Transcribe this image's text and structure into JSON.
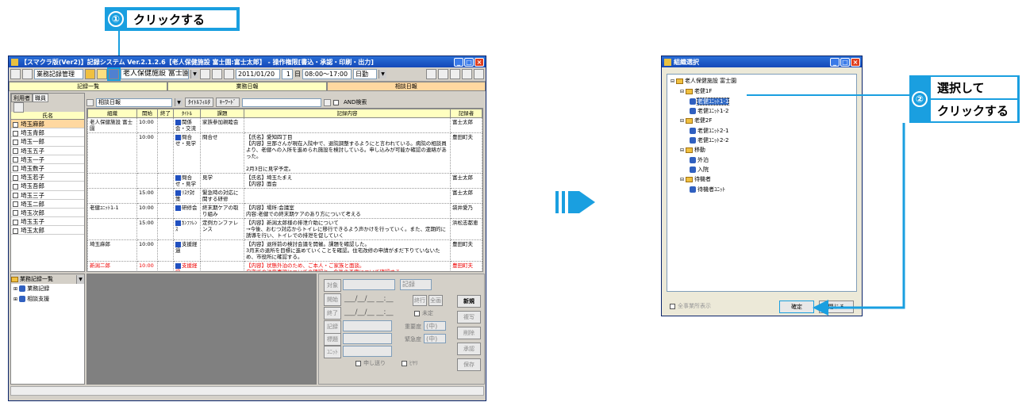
{
  "callout1": {
    "num": "①",
    "text": "クリックする"
  },
  "callout2": {
    "num": "②",
    "line1": "選択して",
    "line2": "クリックする"
  },
  "main_window": {
    "title": "【スマクラ版(Ver2)】記録システム Ver.2.1.2.6【老人保健施設 富士園:富士太郎】 - 操作権限[書込・承認・印刷・出力]",
    "toolbar": {
      "mode": "業務記録管理",
      "facility": "老人保健施設 富士園",
      "date": "2011/01/20",
      "day_value": "1",
      "day_unit": "日",
      "time": "08:00～17:00",
      "time_mode": "日勤"
    },
    "tabs": [
      "記録一覧",
      "業務日報",
      "相談日報"
    ],
    "left_tabs": [
      "利用者",
      "職員"
    ],
    "filter": {
      "select": "相談日報",
      "btn1": "ﾀｲﾄﾙﾌｨﾙﾀ",
      "btn2": "ｷｰﾜｰﾄﾞ",
      "and_label": "AND検索"
    },
    "name_header": "氏名",
    "names": [
      "埼玉麻郎",
      "埼玉青郎",
      "埼玉一郎",
      "埼玉五子",
      "埼玉一子",
      "埼玉数子",
      "埼玉若子",
      "埼玉吾郎",
      "埼玉三子",
      "埼玉二郎",
      "埼玉次郎",
      "埼玉玉子",
      "埼玉太郎"
    ],
    "columns": [
      "組織",
      "開始",
      "終了",
      "ﾀｲﾄﾙ",
      "課題",
      "記録内容",
      "記録者"
    ],
    "rows": [
      {
        "org": "老人保健施設 富士園",
        "start": "10:00",
        "end": "",
        "title": "関係会・交流",
        "issue": "家族参加親睦会",
        "content": "",
        "recorder": "富士太郎",
        "red": false
      },
      {
        "org": "",
        "start": "10:00",
        "end": "",
        "title": "問合せ・見学",
        "issue": "問合せ",
        "content": "【氏名】愛知四丁目\n【内容】旦那さんが現在入院中で、退院調整するようにと言われている。病院の相談員より、老健への入所を進められ施設を検討している。申し込みが可能か確認の連絡があった。\n\n2月3日に見学予定。",
        "recorder": "豊田町夫",
        "red": false
      },
      {
        "org": "",
        "start": "",
        "end": "",
        "title": "問合せ・見学",
        "issue": "見学",
        "content": "【氏名】埼玉たまえ\n【内容】面会",
        "recorder": "富士太郎",
        "red": false
      },
      {
        "org": "",
        "start": "15:00",
        "end": "",
        "title": "ﾘｽｸ対策",
        "issue": "緊急時の対応に関する研修",
        "content": "",
        "recorder": "富士太郎",
        "red": false
      },
      {
        "org": "老健ﾕﾆｯﾄ1-1",
        "start": "10:00",
        "end": "",
        "title": "研修会",
        "issue": "終末期ケアの取り組み",
        "content": "【内容】場所:会議室\n内容:老健での終末期ケアのあり方について考える",
        "recorder": "袋井愛乃",
        "red": false
      },
      {
        "org": "",
        "start": "15:00",
        "end": "",
        "title": "ｶﾝﾌｧﾚﾝｽ",
        "issue": "定例カンファレンス",
        "content": "【内容】新潟太郎様の排泄介助について\n→今後、おむつ対応からトイレに移行できるよう声かけを行っていく。また、定期的に誘導を行い、トイレでの排泄を促していく",
        "recorder": "浜松志都恵",
        "red": false
      },
      {
        "org": "埼玉麻郎",
        "start": "10:00",
        "end": "",
        "title": "支援経過",
        "issue": "",
        "content": "【内容】退所前の検討会議を開催。課題を確認した。\n3月末の退所を目標に進めていくことを確認。住宅改修の申請がまだ下りていないため、市役所に確認する。",
        "recorder": "豊田町夫",
        "red": false
      },
      {
        "org": "新潟二郎",
        "start": "10:00",
        "end": "",
        "title": "支援経過",
        "issue": "",
        "content": "【内容】状態外泊のため、ご本人・ご家族と面談。\n自宅での注意事項についての確認と、今後の予定について確認する。\nご本人の希望:家で過ごせるようになれば言うこと無いけど、最初はそのままでも大丈夫かな。\n家族の希望:お父さんが安心して家で過ごせるようにしてほしい",
        "recorder": "豊田町夫",
        "red": true
      }
    ],
    "bottom_tree_title": "業務記録一覧",
    "bottom_tree": [
      "業務記録",
      "相談支援"
    ],
    "form": {
      "target": "対象",
      "record": "記録",
      "start": "開始",
      "end": "終了",
      "recorder": "記録者",
      "title": "標題",
      "unit": "ﾕﾆｯﾄ",
      "importance": "重要度",
      "urgency": "緊急度",
      "pending": "未定",
      "importance_val": "(中)",
      "urgency_val": "(中)",
      "carry": "申し送り",
      "hiyari": "ﾋﾔﾘ",
      "small1": "終行",
      "small2": "全画",
      "buttons": [
        "新規",
        "複写",
        "削除",
        "承認",
        "保存"
      ]
    }
  },
  "dialog": {
    "title": "組織選択",
    "tree": [
      {
        "label": "老人保健施設 富士園",
        "level": 0,
        "type": "folder"
      },
      {
        "label": "老健1F",
        "level": 1,
        "type": "folder"
      },
      {
        "label": "老健ﾕﾆｯﾄ1-1",
        "level": 2,
        "type": "unit",
        "selected": true
      },
      {
        "label": "老健ﾕﾆｯﾄ1-2",
        "level": 2,
        "type": "unit"
      },
      {
        "label": "老健2F",
        "level": 1,
        "type": "folder"
      },
      {
        "label": "老健ﾕﾆｯﾄ2-1",
        "level": 2,
        "type": "unit"
      },
      {
        "label": "老健ﾕﾆｯﾄ2-2",
        "level": 2,
        "type": "unit"
      },
      {
        "label": "移動",
        "level": 1,
        "type": "folder"
      },
      {
        "label": "外泊",
        "level": 2,
        "type": "unit"
      },
      {
        "label": "入院",
        "level": 2,
        "type": "unit"
      },
      {
        "label": "待機者",
        "level": 1,
        "type": "folder"
      },
      {
        "label": "待機者ﾕﾆｯﾄ",
        "level": 2,
        "type": "unit"
      }
    ],
    "show_all": "全事業所表示",
    "ok": "確定",
    "close": "閉じる"
  }
}
